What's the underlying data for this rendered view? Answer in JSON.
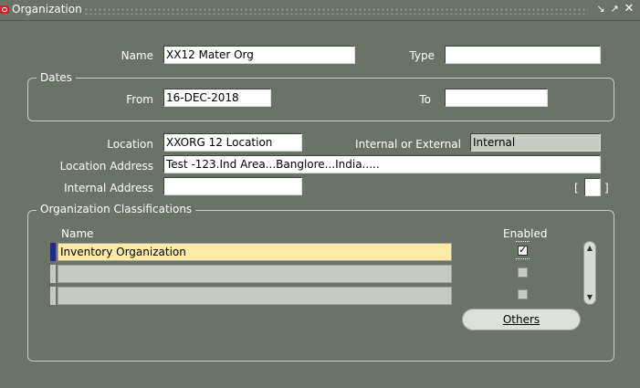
{
  "window": {
    "title": "Organization"
  },
  "form": {
    "name_label": "Name",
    "name_value": "XX12 Mater Org",
    "type_label": "Type",
    "type_value": "",
    "dates_legend": "Dates",
    "from_label": "From",
    "from_value": "16-DEC-2018",
    "to_label": "To",
    "to_value": "",
    "location_label": "Location",
    "location_value": "XXORG 12 Location",
    "int_ext_label": "Internal or External",
    "int_ext_value": "Internal",
    "location_address_label": "Location Address",
    "location_address_value": "Test -123.Ind Area...Banglore...India.....",
    "internal_address_label": "Internal Address",
    "internal_address_value": "",
    "bracket_left": "[",
    "bracket_right": "]"
  },
  "classifications": {
    "legend": "Organization Classifications",
    "name_header": "Name",
    "enabled_header": "Enabled",
    "rows": [
      {
        "name": "Inventory Organization",
        "enabled": true
      },
      {
        "name": "",
        "enabled": false
      },
      {
        "name": "",
        "enabled": false
      }
    ],
    "others_button": "Others"
  },
  "colors": {
    "background": "#6b7268",
    "current_row": "#fdeaa6",
    "readonly_field": "#c9cbc5"
  }
}
